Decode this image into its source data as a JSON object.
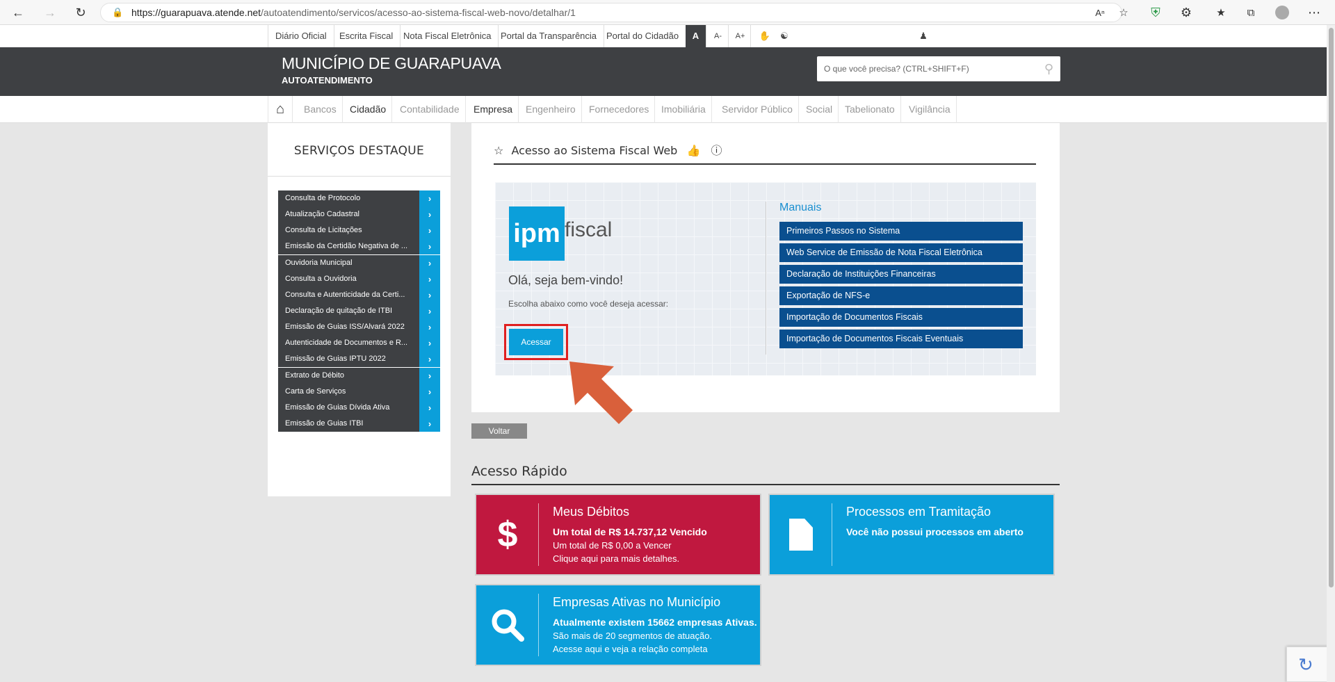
{
  "browser": {
    "url_host": "https://guarapuava.atende.net",
    "url_path": "/autoatendimento/servicos/acesso-ao-sistema-fiscal-web-novo/detalhar/1"
  },
  "toplinks": [
    "Diário Oficial",
    "Escrita Fiscal",
    "Nota Fiscal Eletrônica",
    "Portal da Transparência",
    "Portal do Cidadão"
  ],
  "font_controls": [
    "A",
    "A-",
    "A+"
  ],
  "header": {
    "title": "MUNICÍPIO DE GUARAPUAVA",
    "subtitle": "AUTOATENDIMENTO",
    "search_placeholder": "O que você precisa? (CTRL+SHIFT+F)"
  },
  "nav": [
    "Bancos",
    "Cidadão",
    "Contabilidade",
    "Empresa",
    "Engenheiro",
    "Fornecedores",
    "Imobiliária",
    "Servidor Público",
    "Social",
    "Tabelionato",
    "Vigilância"
  ],
  "sidebar": {
    "title": "SERVIÇOS DESTAQUE",
    "items": [
      "Consulta de Protocolo",
      "Atualização Cadastral",
      "Consulta de Licitações",
      "Emissão da Certidão Negativa de ...",
      "Ouvidoria Municipal",
      "Consulta a Ouvidoria",
      "Consulta e Autenticidade da Certi...",
      "Declaração de quitação de ITBI",
      "Emissão de Guias ISS/Alvará 2022",
      "Autenticidade de Documentos e R...",
      "Emissão de Guias IPTU 2022",
      "Extrato de Débito",
      "Carta de Serviços",
      "Emissão de Guias Dívida Ativa",
      "Emissão de Guias ITBI"
    ]
  },
  "service": {
    "title": "Acesso ao Sistema Fiscal Web",
    "logo_mark": "ipm",
    "logo_text": "fiscal",
    "welcome": "Olá, seja bem-vindo!",
    "choose": "Escolha abaixo como você deseja acessar:",
    "access_button": "Acessar",
    "manuals_title": "Manuais",
    "manuals": [
      "Primeiros Passos no Sistema",
      "Web Service de Emissão de Nota Fiscal Eletrônica",
      "Declaração de Instituições Financeiras",
      "Exportação de NFS-e",
      "Importação de Documentos Fiscais",
      "Importação de Documentos Fiscais Eventuais"
    ]
  },
  "back_button": "Voltar",
  "quick_access": {
    "title": "Acesso Rápido",
    "cards": [
      {
        "title": "Meus Débitos",
        "line1": "Um total de R$ 14.737,12 Vencido",
        "line2": "Um total de R$ 0,00 a Vencer",
        "line3": "Clique aqui para mais detalhes.",
        "icon": "dollar-icon",
        "color": "#c0183f"
      },
      {
        "title": "Processos em Tramitação",
        "line1": "Você não possui processos em aberto",
        "line2": "",
        "line3": "",
        "icon": "document-icon",
        "color": "#0b9fda"
      },
      {
        "title": "Empresas Ativas no Município",
        "line1": "Atualmente existem 15662 empresas Ativas.",
        "line2": "São mais de 20 segmentos de atuação.",
        "line3": "Acesse aqui e veja a relação completa",
        "icon": "search-icon",
        "color": "#0b9fda"
      }
    ]
  },
  "colors": {
    "header_bg": "#3e4043",
    "accent": "#0b9fda",
    "manual_btn": "#0a4f8f",
    "highlight": "#e02020",
    "arrow": "#d9603b"
  }
}
